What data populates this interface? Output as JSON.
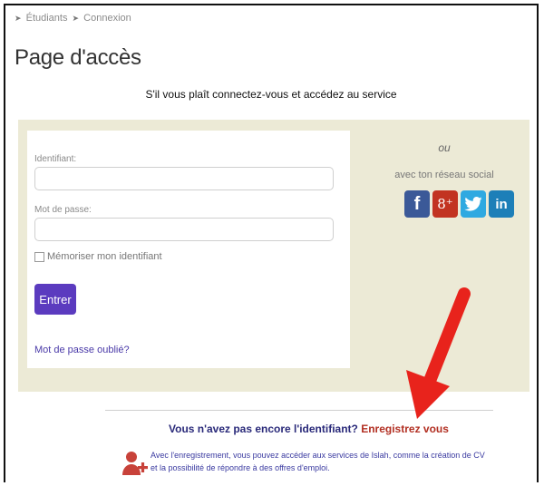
{
  "breadcrumb": {
    "items": [
      "Étudiants",
      "Connexion"
    ],
    "separator": "➤"
  },
  "page": {
    "title": "Page d'accès",
    "subtitle": "S'il vous plaît connectez-vous et accédez au service"
  },
  "login": {
    "username_label": "Identifiant:",
    "username_value": "",
    "password_label": "Mot de passe:",
    "password_value": "",
    "remember_label": "Mémoriser mon identifiant",
    "remember_checked": false,
    "submit_label": "Entrer",
    "forgot_label": "Mot de passe oublié?"
  },
  "social": {
    "or_label": "ou",
    "label": "avec ton réseau social",
    "networks": [
      {
        "name": "facebook",
        "glyph": "f",
        "color": "#3b5998"
      },
      {
        "name": "google-plus",
        "glyph": "8⁺",
        "color": "#c23321"
      },
      {
        "name": "twitter",
        "glyph": "",
        "color": "#2fa9e1"
      },
      {
        "name": "linkedin",
        "glyph": "in",
        "color": "#1d7fb8"
      }
    ]
  },
  "register": {
    "question": "Vous n'avez pas encore l'identifiant?",
    "link": "Enregistrez vous",
    "note": "Avec l'enregistrement, vous pouvez accéder aux services de Islah, comme la création de CV et la possibilité de répondre à des offres d'emploi."
  },
  "colors": {
    "panel_bg": "#ecead6",
    "submit_bg": "#5b3bbf",
    "register_link": "#b22f22",
    "annotation_arrow": "#e8231c"
  }
}
